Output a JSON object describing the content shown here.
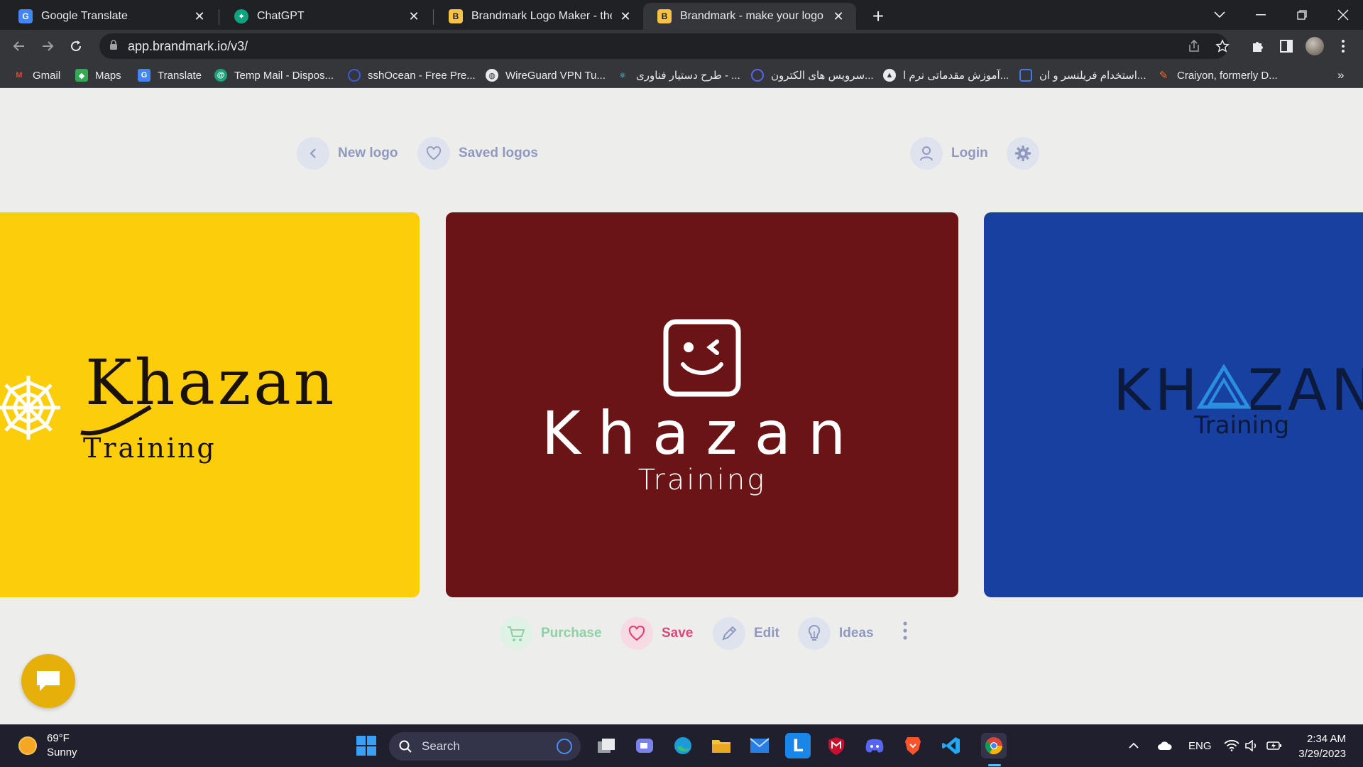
{
  "browser": {
    "tabs": [
      {
        "title": "Google Translate",
        "favicon_color": "#4285f4",
        "favicon_text": "G"
      },
      {
        "title": "ChatGPT",
        "favicon_color": "#10a37f",
        "favicon_text": ""
      },
      {
        "title": "Brandmark Logo Maker - the mo",
        "favicon_color": "#f6c342",
        "favicon_text": "B"
      },
      {
        "title": "Brandmark - make your logo in n",
        "favicon_color": "#f6c342",
        "favicon_text": "B",
        "active": true
      }
    ],
    "url": "app.brandmark.io/v3/",
    "bookmarks": [
      {
        "label": "Gmail",
        "icon": "gmail-icon",
        "color": "#ea4335"
      },
      {
        "label": "Maps",
        "icon": "maps-icon",
        "color": "#34a853"
      },
      {
        "label": "Translate",
        "icon": "translate-icon",
        "color": "#4285f4"
      },
      {
        "label": "Temp Mail - Dispos...",
        "icon": "tempmail-icon",
        "color": "#1aa37a"
      },
      {
        "label": "sshOcean - Free Pre...",
        "icon": "sshocean-icon",
        "color": "#3a5bd9"
      },
      {
        "label": "WireGuard VPN Tu...",
        "icon": "globe-icon",
        "color": "#e8eaed"
      },
      {
        "label": "طرح دستیار فناوری - ...",
        "icon": "react-icon",
        "color": "#61dafb"
      },
      {
        "label": "سرویس های الکترون...",
        "icon": "service-icon",
        "color": "#5865f2"
      },
      {
        "label": "آموزش مقدماتی نرم ا...",
        "icon": "course-icon",
        "color": "#e8eaed"
      },
      {
        "label": "استخدام فریلنسر و ان...",
        "icon": "freelance-icon",
        "color": "#3d7cf0"
      },
      {
        "label": "Craiyon, formerly D...",
        "icon": "pencil-icon",
        "color": "#f26b21"
      }
    ]
  },
  "app": {
    "nav": {
      "new_logo": "New logo",
      "saved_logos": "Saved logos",
      "login": "Login"
    },
    "logos": [
      {
        "name": "Khazan",
        "tagline": "Training",
        "bg": "#fbcd0a",
        "fg": "#1a1208"
      },
      {
        "name": "Khazan",
        "tagline": "Training",
        "bg": "#6b1416",
        "fg": "#ffffff"
      },
      {
        "name": "KHAZAN",
        "tagline": "Training",
        "bg": "#1840a0",
        "fg": "#0c1a3e"
      }
    ],
    "actions": {
      "purchase": "Purchase",
      "save": "Save",
      "edit": "Edit",
      "ideas": "Ideas"
    },
    "colors": {
      "purchase": "#8fd1a6",
      "save": "#e0457a",
      "edit": "#8f99bf",
      "ideas": "#8f99bf"
    }
  },
  "taskbar": {
    "weather_temp": "69°F",
    "weather_desc": "Sunny",
    "search_placeholder": "Search",
    "language": "ENG",
    "time": "2:34 AM",
    "date": "3/29/2023"
  }
}
